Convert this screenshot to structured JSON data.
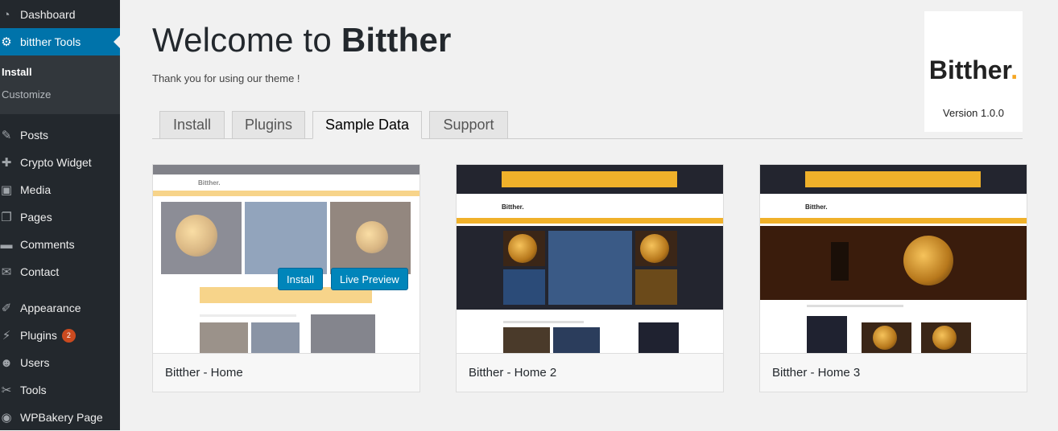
{
  "sidebar": {
    "items": [
      {
        "label": "Dashboard",
        "icon": "dashboard-icon"
      },
      {
        "label": "bitther Tools",
        "icon": "gear-icon"
      },
      {
        "label": "Posts",
        "icon": "pin-icon"
      },
      {
        "label": "Crypto Widget",
        "icon": "wrench-icon"
      },
      {
        "label": "Media",
        "icon": "media-icon"
      },
      {
        "label": "Pages",
        "icon": "pages-icon"
      },
      {
        "label": "Comments",
        "icon": "comments-icon"
      },
      {
        "label": "Contact",
        "icon": "mail-icon"
      },
      {
        "label": "Appearance",
        "icon": "brush-icon"
      },
      {
        "label": "Plugins",
        "icon": "plug-icon",
        "badge": "2"
      },
      {
        "label": "Users",
        "icon": "users-icon"
      },
      {
        "label": "Tools",
        "icon": "tools-icon"
      },
      {
        "label": "WPBakery Page",
        "icon": "wpbakery-icon"
      }
    ],
    "submenu": [
      {
        "label": "Install"
      },
      {
        "label": "Customize"
      }
    ]
  },
  "header": {
    "title_prefix": "Welcome to ",
    "title_brand": "Bitther",
    "subtitle": "Thank you for using our theme !"
  },
  "logo": {
    "text": "Bitther",
    "dot": ".",
    "version": "Version 1.0.0"
  },
  "tabs": [
    {
      "label": "Install"
    },
    {
      "label": "Plugins"
    },
    {
      "label": "Sample Data"
    },
    {
      "label": "Support"
    }
  ],
  "active_tab": "Sample Data",
  "demos": [
    {
      "name": "Bitther - Home",
      "install_label": "Install",
      "preview_label": "Live Preview"
    },
    {
      "name": "Bitther - Home 2"
    },
    {
      "name": "Bitther - Home 3"
    }
  ],
  "colors": {
    "sidebar_bg": "#23282d",
    "active_menu": "#0073aa",
    "button": "#0085ba",
    "badge": "#ca4a1f",
    "brand_accent": "#f5a623"
  }
}
